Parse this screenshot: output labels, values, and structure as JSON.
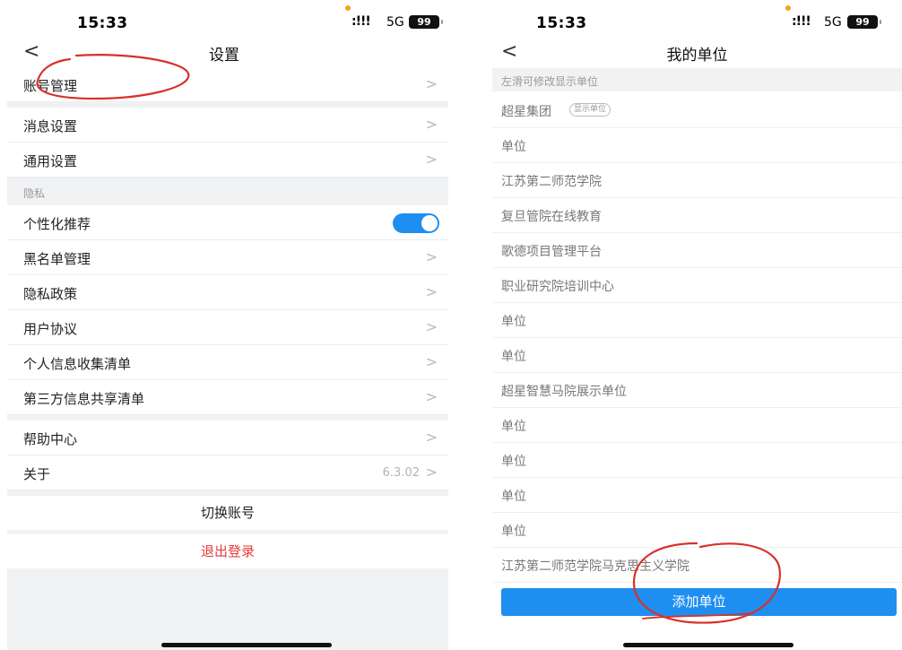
{
  "left": {
    "status": {
      "time": "15:33",
      "signal": ":!!!",
      "network": "5G",
      "battery": "99"
    },
    "nav": {
      "back": "<",
      "title": "设置"
    },
    "rows": {
      "account": "账号管理",
      "message": "消息设置",
      "general": "通用设置",
      "privacy_section": "隐私",
      "personalized": "个性化推荐",
      "blacklist": "黑名单管理",
      "privacy_policy": "隐私政策",
      "user_agreement": "用户协议",
      "personal_info": "个人信息收集清单",
      "third_party": "第三方信息共享清单",
      "help": "帮助中心",
      "about": "关于",
      "version": "6.3.02"
    },
    "chevron": ">",
    "switch_account": "切换账号",
    "logout": "退出登录",
    "personalized_enabled": true
  },
  "right": {
    "status": {
      "time": "15:33",
      "signal": ":!!!",
      "network": "5G",
      "battery": "99"
    },
    "nav": {
      "back": "<",
      "title": "我的单位"
    },
    "hint": "左滑可修改显示单位",
    "units": [
      {
        "name": "超星集团",
        "badge": "显示单位"
      },
      {
        "name": "单位"
      },
      {
        "name": "江苏第二师范学院"
      },
      {
        "name": "复旦管院在线教育"
      },
      {
        "name": "歌德项目管理平台"
      },
      {
        "name": "职业研究院培训中心"
      },
      {
        "name": "单位"
      },
      {
        "name": "单位"
      },
      {
        "name": "超星智慧马院展示单位"
      },
      {
        "name": "单位"
      },
      {
        "name": "单位"
      },
      {
        "name": "单位"
      },
      {
        "name": "单位"
      },
      {
        "name": "江苏第二师范学院马克思主义学院"
      }
    ],
    "add_button": "添加单位"
  },
  "colors": {
    "accent": "#1e8ef0",
    "logout": "#e53935",
    "annotation": "#d9302a",
    "separator": "#f1f2f4"
  },
  "icons": {
    "back": "chevron-left-icon",
    "row_arrow": "chevron-right-icon"
  }
}
